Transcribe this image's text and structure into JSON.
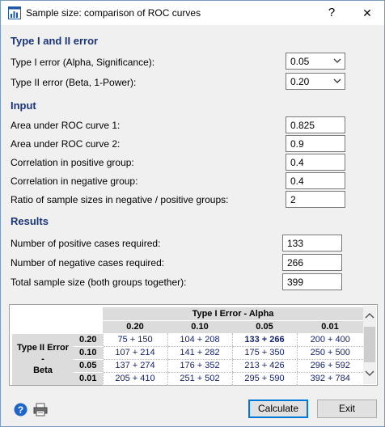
{
  "window": {
    "title": "Sample size: comparison of ROC curves",
    "help_glyph": "?",
    "close_glyph": "✕"
  },
  "sections": {
    "error": "Type I and II error",
    "input": "Input",
    "results": "Results"
  },
  "error": {
    "alpha_label": "Type I error (Alpha, Significance):",
    "alpha_value": "0.05",
    "beta_label": "Type II error (Beta, 1-Power):",
    "beta_value": "0.20"
  },
  "input": {
    "auc1_label": "Area under ROC curve 1:",
    "auc1_value": "0.825",
    "auc2_label": "Area under ROC curve 2:",
    "auc2_value": "0.9",
    "corr_pos_label": "Correlation in positive group:",
    "corr_pos_value": "0.4",
    "corr_neg_label": "Correlation in negative group:",
    "corr_neg_value": "0.4",
    "ratio_label": "Ratio of sample sizes in negative / positive groups:",
    "ratio_value": "2"
  },
  "results": {
    "pos_label": "Number of positive cases required:",
    "pos_value": "133",
    "neg_label": "Number of negative cases required:",
    "neg_value": "266",
    "total_label": "Total sample size (both groups together):",
    "total_value": "399"
  },
  "table": {
    "col_group": "Type I Error - Alpha",
    "col_headers": [
      "0.20",
      "0.10",
      "0.05",
      "0.01"
    ],
    "row_group_line1": "Type II Error",
    "row_group_line2": "-",
    "row_group_line3": "Beta",
    "rows": [
      {
        "beta": "0.20",
        "cells": [
          "75 + 150",
          "104 + 208",
          "133 + 266",
          "200 + 400"
        ]
      },
      {
        "beta": "0.10",
        "cells": [
          "107 + 214",
          "141 + 282",
          "175 + 350",
          "250 + 500"
        ]
      },
      {
        "beta": "0.05",
        "cells": [
          "137 + 274",
          "176 + 352",
          "213 + 426",
          "296 + 592"
        ]
      },
      {
        "beta": "0.01",
        "cells": [
          "205 + 410",
          "251 + 502",
          "295 + 590",
          "392 + 784"
        ]
      }
    ]
  },
  "buttons": {
    "calculate": "Calculate",
    "exit": "Exit"
  },
  "colors": {
    "section_heading": "#1a3578",
    "cell_text": "#16246a",
    "default_button_border": "#0078d7"
  }
}
